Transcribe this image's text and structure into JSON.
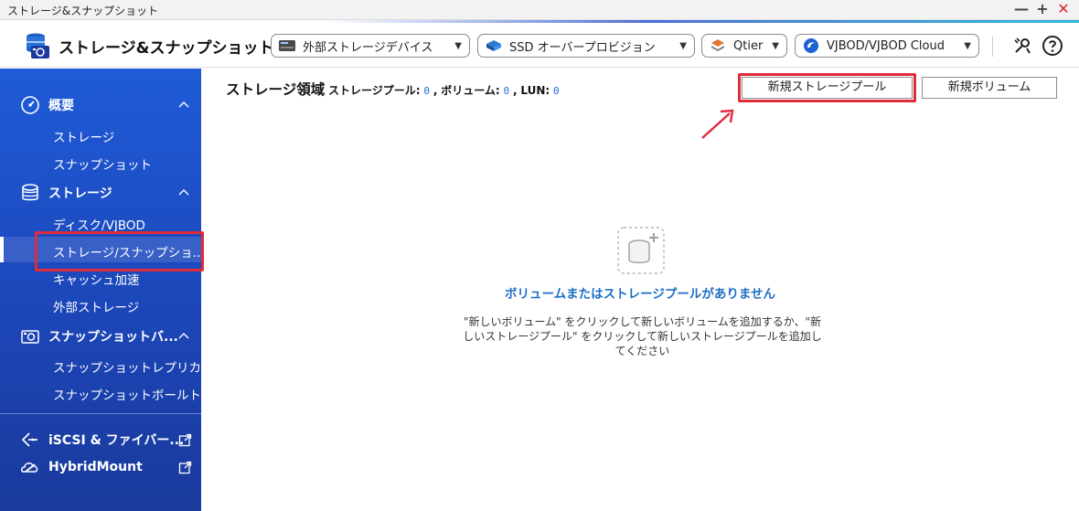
{
  "window": {
    "title": "ストレージ&スナップショット",
    "controls": {
      "minimize": "—",
      "maximize": "+",
      "close": "✕"
    }
  },
  "toolbar": {
    "app_title": "ストレージ&スナップショット",
    "dropdowns": [
      {
        "label": "外部ストレージデバイス",
        "icon": "external-storage-icon"
      },
      {
        "label": "SSD オーバープロビジョン",
        "icon": "ssd-icon"
      },
      {
        "label": "Qtier",
        "icon": "qtier-icon"
      },
      {
        "label": "VJBOD/VJBOD Cloud",
        "icon": "vjbod-cloud-icon"
      }
    ],
    "right_icons": [
      "tools-icon",
      "help-icon"
    ]
  },
  "sidebar": {
    "sections": [
      {
        "label": "概要",
        "icon": "gauge-icon",
        "items": [
          "ストレージ",
          "スナップショット"
        ]
      },
      {
        "label": "ストレージ",
        "icon": "database-icon",
        "items": [
          "ディスク/VJBOD",
          "ストレージ/スナップショ...",
          "キャッシュ加速",
          "外部ストレージ"
        ]
      },
      {
        "label": "スナップショットバ...",
        "icon": "snapshot-camera-icon",
        "items": [
          "スナップショットレプリカ",
          "スナップショットボールト"
        ]
      }
    ],
    "links": [
      {
        "label": "iSCSI & ファイバー...",
        "icon": "iscsi-icon"
      },
      {
        "label": "HybridMount",
        "icon": "hybridmount-icon"
      }
    ],
    "active_item": "ストレージ/スナップショ..."
  },
  "main": {
    "header": {
      "title": "ストレージ領域",
      "pool_label": "ストレージプール:",
      "pool_count": "0",
      "sep1": ",",
      "volume_label": "ボリューム:",
      "volume_count": "0",
      "sep2": ",",
      "lun_label": "LUN:",
      "lun_count": "0"
    },
    "buttons": {
      "new_pool": "新規ストレージプール",
      "new_volume": "新規ボリューム"
    },
    "empty_state": {
      "title": "ボリュームまたはストレージプールがありません",
      "desc_line1": "\"新しいボリューム\" をクリックして新しいボリュームを追加するか、\"新",
      "desc_line2": "しいストレージプール\" をクリックして新しいストレージプールを追加し",
      "desc_line3": "てください"
    }
  },
  "colors": {
    "sidebar_top": "#1f5bd8",
    "sidebar_bottom": "#1a3a9c",
    "highlight_red": "#e02b3a",
    "link_blue": "#1c6fc4"
  }
}
